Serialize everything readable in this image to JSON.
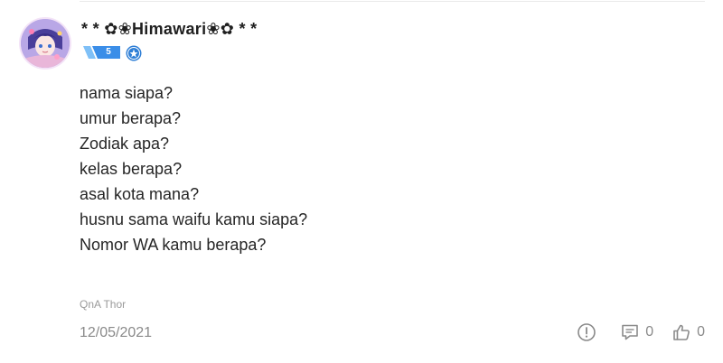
{
  "post": {
    "author": {
      "name": "* * ✿❀Himawari❀✿ * *",
      "level": "5",
      "avatar_icon": "anime-avatar-icon",
      "role_icon": "verified-role-icon"
    },
    "lines": [
      "nama siapa?",
      "umur berapa?",
      "Zodiak apa?",
      "kelas berapa?",
      "asal kota mana?",
      "husnu sama waifu kamu siapa?",
      "Nomor WA kamu berapa?"
    ],
    "source": "QnA Thor",
    "date": "12/05/2021",
    "actions": {
      "report_icon": "report-icon",
      "comment_icon": "comment-icon",
      "comment_count": "0",
      "like_icon": "thumbs-up-icon",
      "like_count": "0"
    }
  },
  "colors": {
    "level_badge": "#3b8ee8",
    "role_badge": "#2f7fd6",
    "muted_text": "#8a8a8a"
  }
}
